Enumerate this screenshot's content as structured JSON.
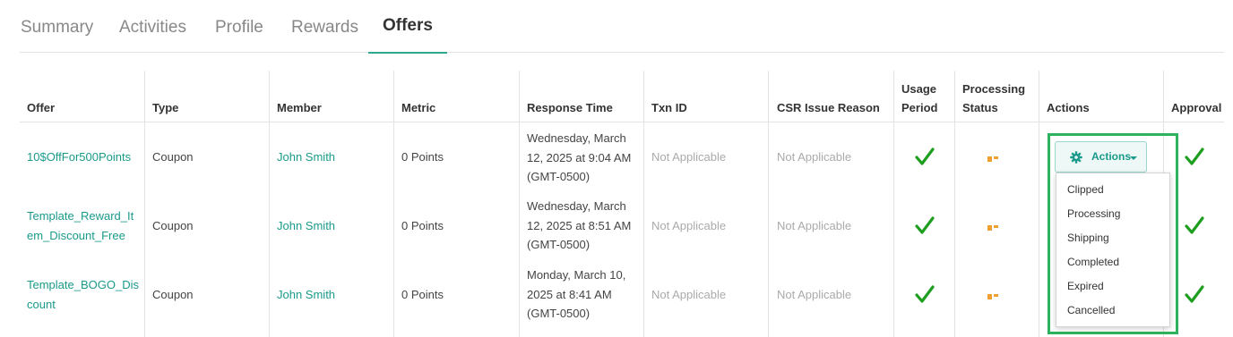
{
  "tabs": [
    {
      "label": "Summary"
    },
    {
      "label": "Activities"
    },
    {
      "label": "Profile"
    },
    {
      "label": "Rewards"
    },
    {
      "label": "Offers",
      "active": true
    }
  ],
  "table": {
    "headers": {
      "offer": "Offer",
      "type": "Type",
      "member": "Member",
      "metric": "Metric",
      "response_time": "Response Time",
      "txn_id": "Txn ID",
      "csr_issue_reason": "CSR Issue Reason",
      "usage_period_1": "Usage",
      "usage_period_2": "Period",
      "processing_status_1": "Processing",
      "processing_status_2": "Status",
      "actions": "Actions",
      "approval": "Approval"
    },
    "rows": [
      {
        "offer_lines": [
          "10$OffFor500Points"
        ],
        "type": "Coupon",
        "member": "John Smith",
        "metric": "0 Points",
        "response_lines": [
          "Wednesday, March",
          "12, 2025 at 9:04 AM",
          "(GMT-0500)"
        ],
        "txn_id": "Not Applicable",
        "csr_issue_reason": "Not Applicable",
        "usage_period": "check-icon",
        "processing_status": "pending-dashes-icon",
        "approval": "check-icon"
      },
      {
        "offer_lines": [
          "Template_Reward_It",
          "em_Discount_Free"
        ],
        "type": "Coupon",
        "member": "John Smith",
        "metric": "0 Points",
        "response_lines": [
          "Wednesday, March",
          "12, 2025 at 8:51 AM",
          "(GMT-0500)"
        ],
        "txn_id": "Not Applicable",
        "csr_issue_reason": "Not Applicable",
        "usage_period": "check-icon",
        "processing_status": "pending-dashes-icon",
        "approval": "check-icon"
      },
      {
        "offer_lines": [
          "Template_BOGO_Dis",
          "count"
        ],
        "type": "Coupon",
        "member": "John Smith",
        "metric": "0 Points",
        "response_lines": [
          "Monday, March 10,",
          "2025 at 8:41 AM",
          "(GMT-0500)"
        ],
        "txn_id": "Not Applicable",
        "csr_issue_reason": "Not Applicable",
        "usage_period": "check-icon",
        "processing_status": "pending-dashes-icon",
        "approval": "check-icon"
      }
    ]
  },
  "actions": {
    "button_label": "Actions",
    "button_icon": "gear-icon",
    "menu_items": [
      "Clipped",
      "Processing",
      "Shipping",
      "Completed",
      "Expired",
      "Cancelled"
    ]
  },
  "colors": {
    "accent": "#1a9a8a",
    "tab_underline": "#2aa98f",
    "check": "#1e9e1e",
    "pending": "#f0a030",
    "highlight_box": "#2db35d"
  }
}
